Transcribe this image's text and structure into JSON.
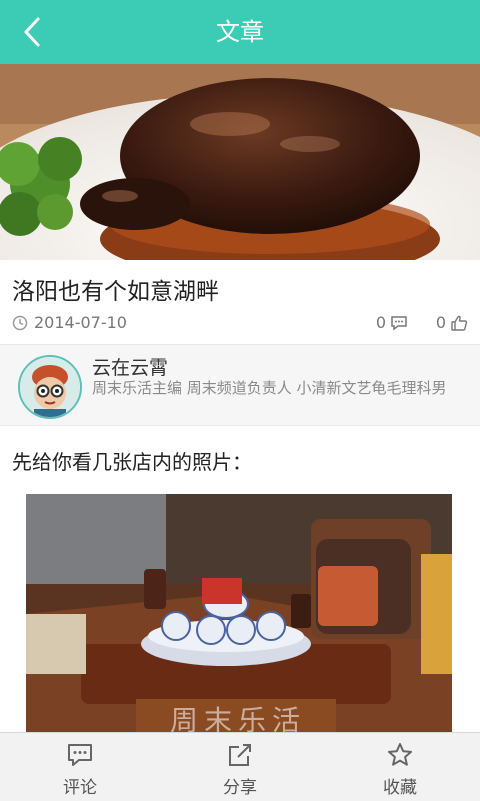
{
  "header": {
    "title": "文章",
    "back_icon": "chevron-left-icon"
  },
  "article": {
    "title": "洛阳也有个如意湖畔",
    "date": "2014-07-10",
    "comment_count": "0",
    "like_count": "0"
  },
  "author": {
    "name": "云在云霄",
    "bio": "周末乐活主编 周末频道负责人 小清新文艺龟毛理科男"
  },
  "body": {
    "intro": "先给你看几张店内的照片：",
    "watermark": "周末乐活"
  },
  "bottom_tabs": [
    {
      "label": "评论",
      "icon": "comment-icon"
    },
    {
      "label": "分享",
      "icon": "share-icon"
    },
    {
      "label": "收藏",
      "icon": "star-icon"
    }
  ],
  "colors": {
    "accent": "#3ccbb4"
  }
}
